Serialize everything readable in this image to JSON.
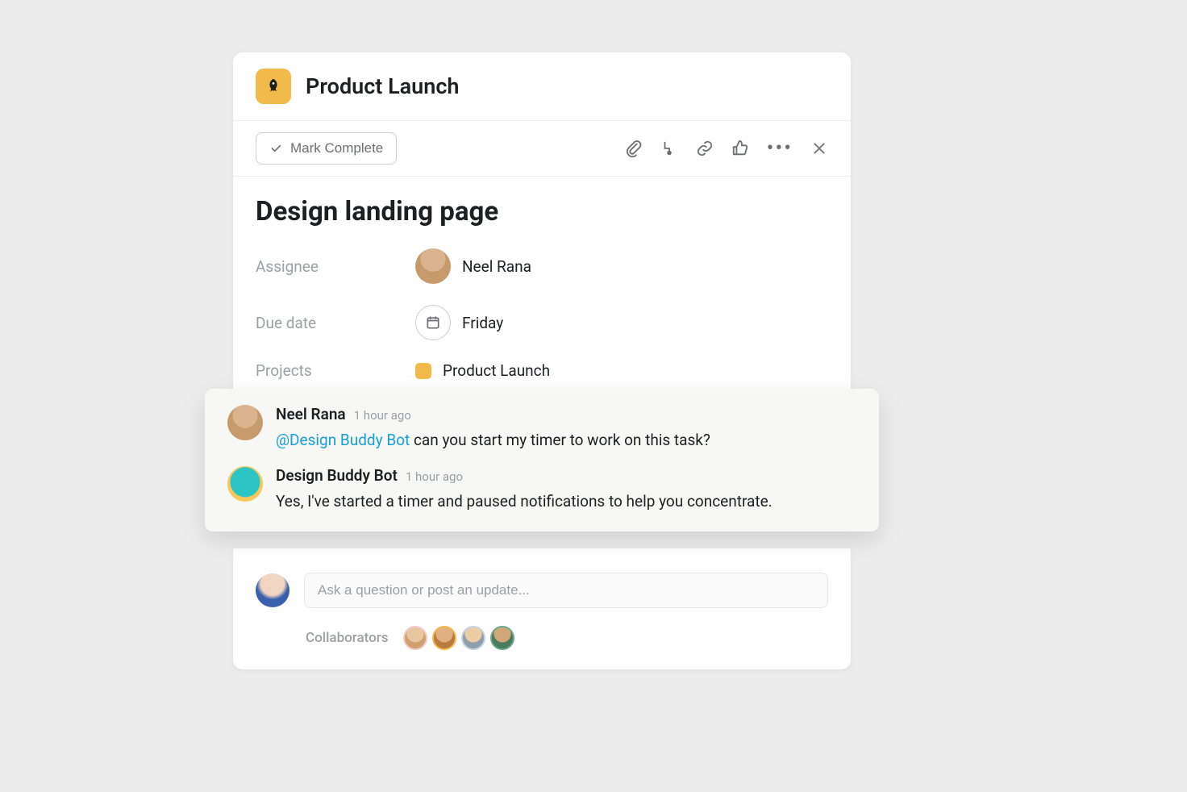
{
  "header": {
    "project_name": "Product Launch"
  },
  "toolbar": {
    "mark_complete_label": "Mark Complete"
  },
  "task": {
    "title": "Design landing page",
    "assignee_label": "Assignee",
    "assignee_name": "Neel Rana",
    "due_label": "Due date",
    "due_value": "Friday",
    "projects_label": "Projects",
    "project_value": "Product Launch"
  },
  "comments": [
    {
      "author": "Neel Rana",
      "time": "1 hour ago",
      "mention": "@Design Buddy Bot",
      "text_after_mention": " can you start my timer to work on this task?"
    },
    {
      "author": "Design Buddy Bot",
      "time": "1 hour ago",
      "body": "Yes, I've started a timer and paused notifications to help you concentrate."
    }
  ],
  "compose": {
    "placeholder": "Ask a question or post an update..."
  },
  "collaborators": {
    "label": "Collaborators"
  }
}
